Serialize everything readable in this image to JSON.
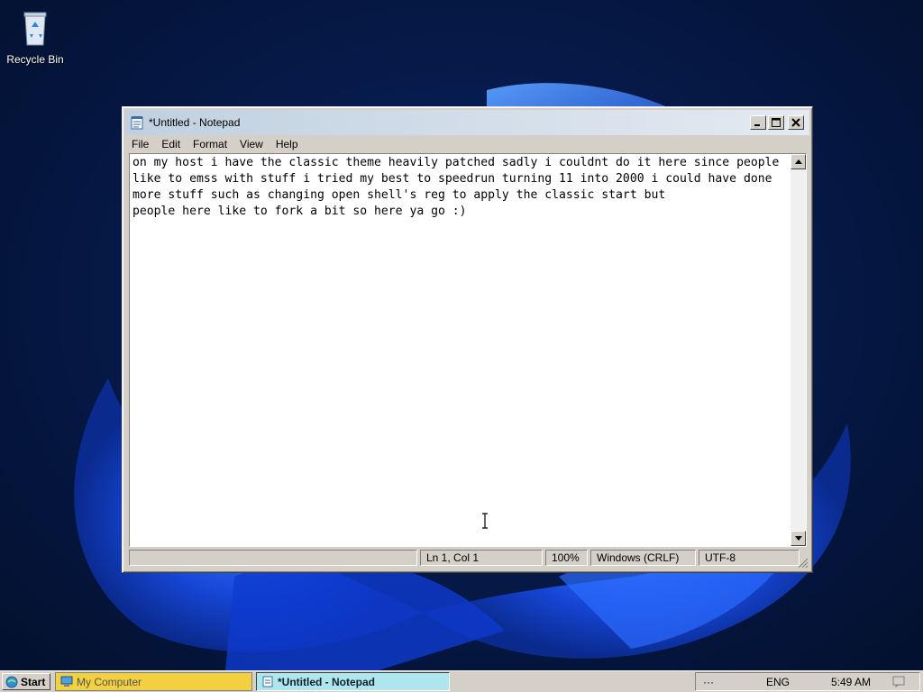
{
  "desktop": {
    "recycle_bin_label": "Recycle Bin",
    "recycle_bin_icon": "recycle-bin-icon"
  },
  "notepad": {
    "title": "*Untitled - Notepad",
    "menu": [
      "File",
      "Edit",
      "Format",
      "View",
      "Help"
    ],
    "content_lines": [
      "on my host i have the classic theme heavily patched sadly i couldnt do it here since people",
      "like to emss with stuff i tried my best to speedrun turning 11 into 2000 i could have done",
      "more stuff such as changing open shell's reg to apply the classic start but",
      "people here like to fork a bit so here ya go :)"
    ],
    "status": {
      "position": "Ln 1, Col 1",
      "zoom": "100%",
      "line_ending": "Windows (CRLF)",
      "encoding": "UTF-8"
    }
  },
  "taskbar": {
    "start_label": "Start",
    "tasks": [
      {
        "label": "My Computer",
        "active": false
      },
      {
        "label": "*Untitled - Notepad",
        "active": true
      }
    ],
    "tray": {
      "overflow": "···",
      "language": "ENG",
      "time": "5:49 AM"
    }
  },
  "colors": {
    "desktop_bg": "#06173f",
    "window_face": "#d4d0c8",
    "active_task": "#aee6ee",
    "mycomputer_task": "#f2d040"
  }
}
